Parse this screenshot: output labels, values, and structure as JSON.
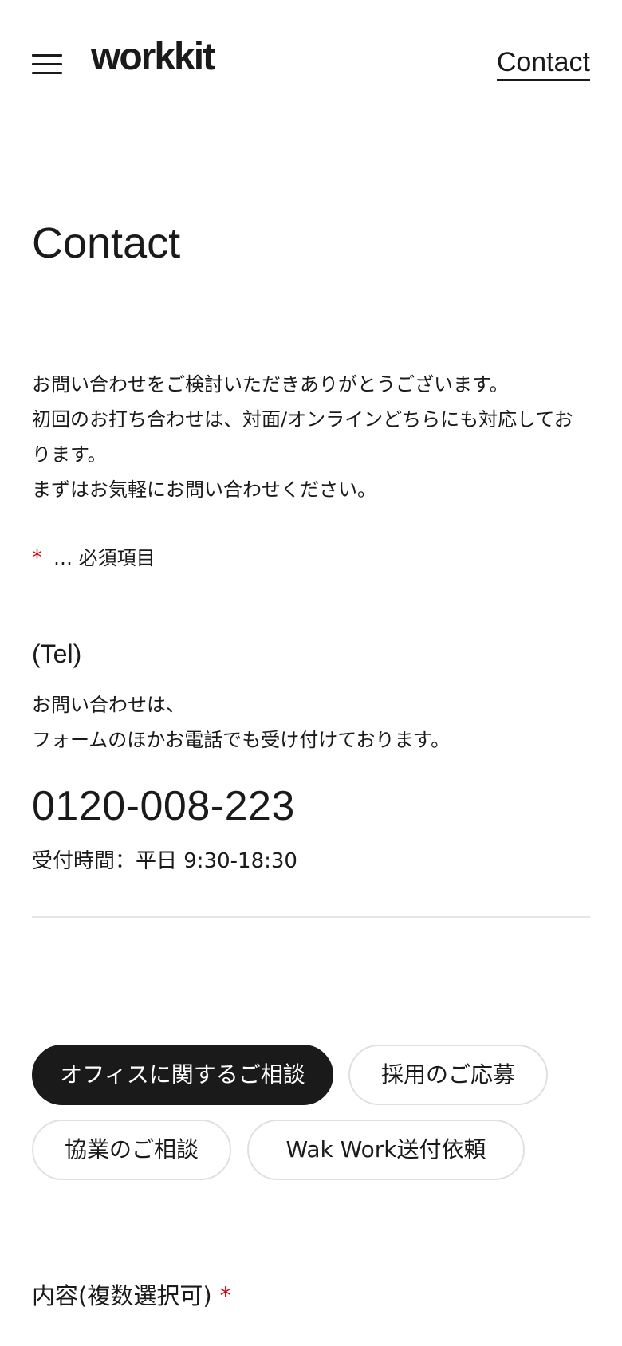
{
  "header": {
    "logo": "workkit",
    "nav_contact": "Contact"
  },
  "main": {
    "title": "Contact",
    "intro": [
      "お問い合わせをご検討いただきありがとうございます。",
      "初回のお打ち合わせは、対面/オンラインどちらにも対応しております。",
      "まずはお気軽にお問い合わせください。"
    ],
    "required_note": {
      "mark": "*",
      "text": "… 必須項目"
    },
    "tel": {
      "heading": "(Tel)",
      "desc": [
        "お問い合わせは、",
        "フォームのほかお電話でも受け付けております。"
      ],
      "number": "0120-008-223",
      "hours": "受付時間：平日 9:30-18:30"
    },
    "categories": [
      {
        "label": "オフィスに関するご相談",
        "active": true
      },
      {
        "label": "採用のご応募",
        "active": false
      },
      {
        "label": "協業のご相談",
        "active": false
      },
      {
        "label": "Wak Work送付依頼",
        "active": false
      }
    ],
    "field_label": {
      "text": "内容(複数選択可)",
      "mark": "*"
    }
  },
  "colors": {
    "text": "#1a1a1a",
    "required": "#d7000f",
    "pill_active_bg": "#1a1a1a",
    "pill_border": "#e0e0e0"
  }
}
